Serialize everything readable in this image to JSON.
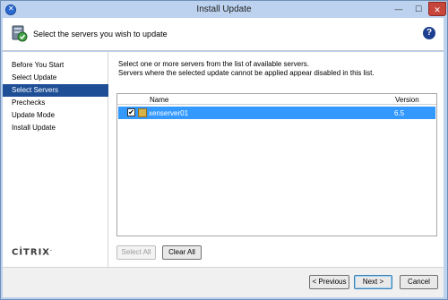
{
  "window": {
    "title": "Install Update"
  },
  "titlebar": {
    "minimize_glyph": "—",
    "maximize_glyph": "☐",
    "close_glyph": "✕"
  },
  "header": {
    "title": "Select the servers you wish to update",
    "help_glyph": "?"
  },
  "sidebar": {
    "items": [
      {
        "label": "Before You Start",
        "active": false
      },
      {
        "label": "Select Update",
        "active": false
      },
      {
        "label": "Select Servers",
        "active": true
      },
      {
        "label": "Prechecks",
        "active": false
      },
      {
        "label": "Update Mode",
        "active": false
      },
      {
        "label": "Install Update",
        "active": false
      }
    ],
    "logo_text": "CİTRIX"
  },
  "main": {
    "instruction_line1": "Select one or more servers from the list of available servers.",
    "instruction_line2": "Servers where the selected update cannot be applied appear disabled in this list.",
    "grid": {
      "columns": [
        "Name",
        "Version"
      ],
      "rows": [
        {
          "checked": true,
          "check_glyph": "✔",
          "name": "xenserver01",
          "version": "6.5"
        }
      ]
    },
    "select_all_label": "Select All",
    "clear_all_label": "Clear All"
  },
  "footer": {
    "previous_label": "< Previous",
    "next_label": "Next >",
    "cancel_label": "Cancel"
  },
  "colors": {
    "selection": "#3399ff",
    "active_nav": "#1e4f96",
    "window_frame": "#bcd2ee"
  }
}
